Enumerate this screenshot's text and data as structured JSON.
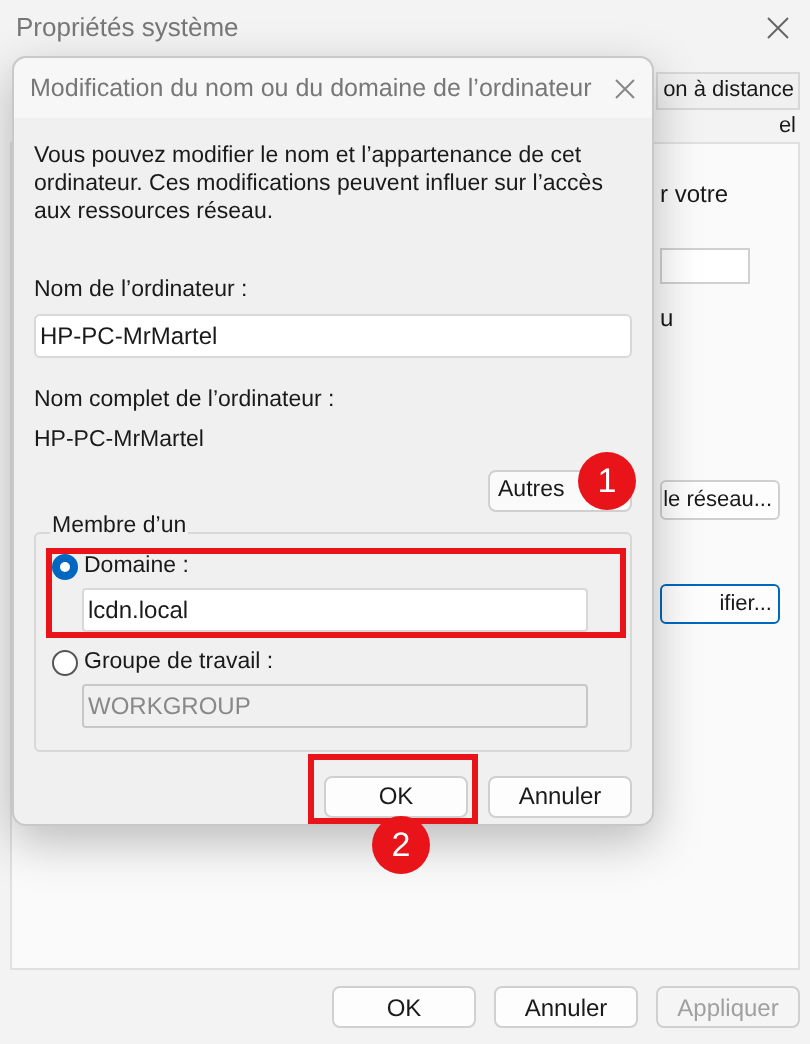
{
  "window": {
    "title": "Propriétés système",
    "tabs": [
      {
        "label": "on à distance"
      },
      {
        "label": "el"
      }
    ],
    "fragments": [
      "r votre",
      "u"
    ],
    "panel_buttons": [
      {
        "label": "le réseau...",
        "focused": false
      },
      {
        "label": "ifier...",
        "focused": true
      }
    ],
    "buttons": [
      {
        "label": "OK",
        "disabled": false
      },
      {
        "label": "Annuler",
        "disabled": false
      },
      {
        "label": "Appliquer",
        "disabled": true
      }
    ]
  },
  "dialog": {
    "title": "Modification du nom ou du domaine de l’ordinateur",
    "description": "Vous pouvez modifier le nom et l’appartenance de cet ordinateur. Ces modifications peuvent influer sur l’accès aux ressources réseau.",
    "computer_name": {
      "label": "Nom de l’ordinateur :",
      "value": "HP-PC-MrMartel"
    },
    "full_name": {
      "label": "Nom complet de l’ordinateur :",
      "value": "HP-PC-MrMartel"
    },
    "more_button": "Autres",
    "member": {
      "legend": "Membre d’un",
      "options": [
        {
          "label": "Domaine :",
          "selected": true,
          "value": "lcdn.local"
        },
        {
          "label": "Groupe de travail :",
          "selected": false,
          "value": "WORKGROUP"
        }
      ]
    },
    "buttons": [
      {
        "label": "OK"
      },
      {
        "label": "Annuler"
      }
    ],
    "annotations": [
      "1",
      "2"
    ]
  }
}
